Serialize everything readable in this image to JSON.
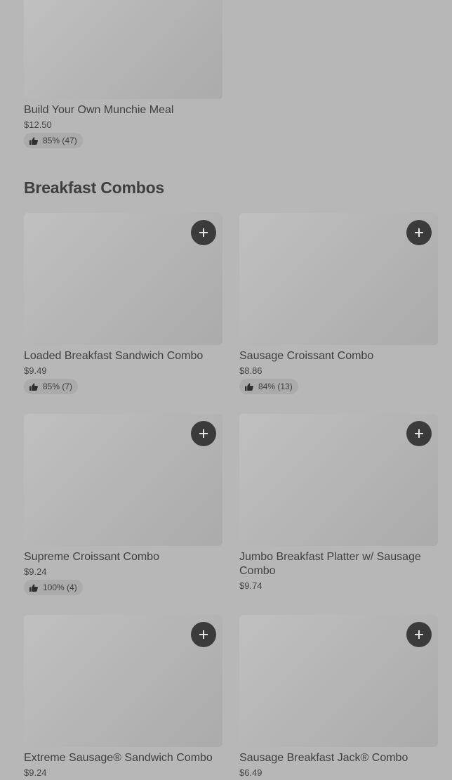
{
  "top_item": {
    "name": "Build Your Own Munchie Meal",
    "price": "$12.50",
    "rating": "85% (47)"
  },
  "section": {
    "title": "Breakfast Combos"
  },
  "items": [
    {
      "name": "Loaded Breakfast Sandwich Combo",
      "price": "$9.49",
      "rating": "85% (7)"
    },
    {
      "name": "Sausage Croissant Combo",
      "price": "$8.86",
      "rating": "84% (13)"
    },
    {
      "name": "Supreme Croissant Combo",
      "price": "$9.24",
      "rating": "100% (4)"
    },
    {
      "name": "Jumbo Breakfast Platter w/ Sausage Combo",
      "price": "$9.74"
    },
    {
      "name": "Extreme Sausage® Sandwich Combo",
      "price": "$9.24"
    },
    {
      "name": "Sausage Breakfast Jack® Combo",
      "price": "$6.49"
    }
  ],
  "icons": {
    "add": "plus-icon",
    "rating": "thumbs-up-icon"
  }
}
